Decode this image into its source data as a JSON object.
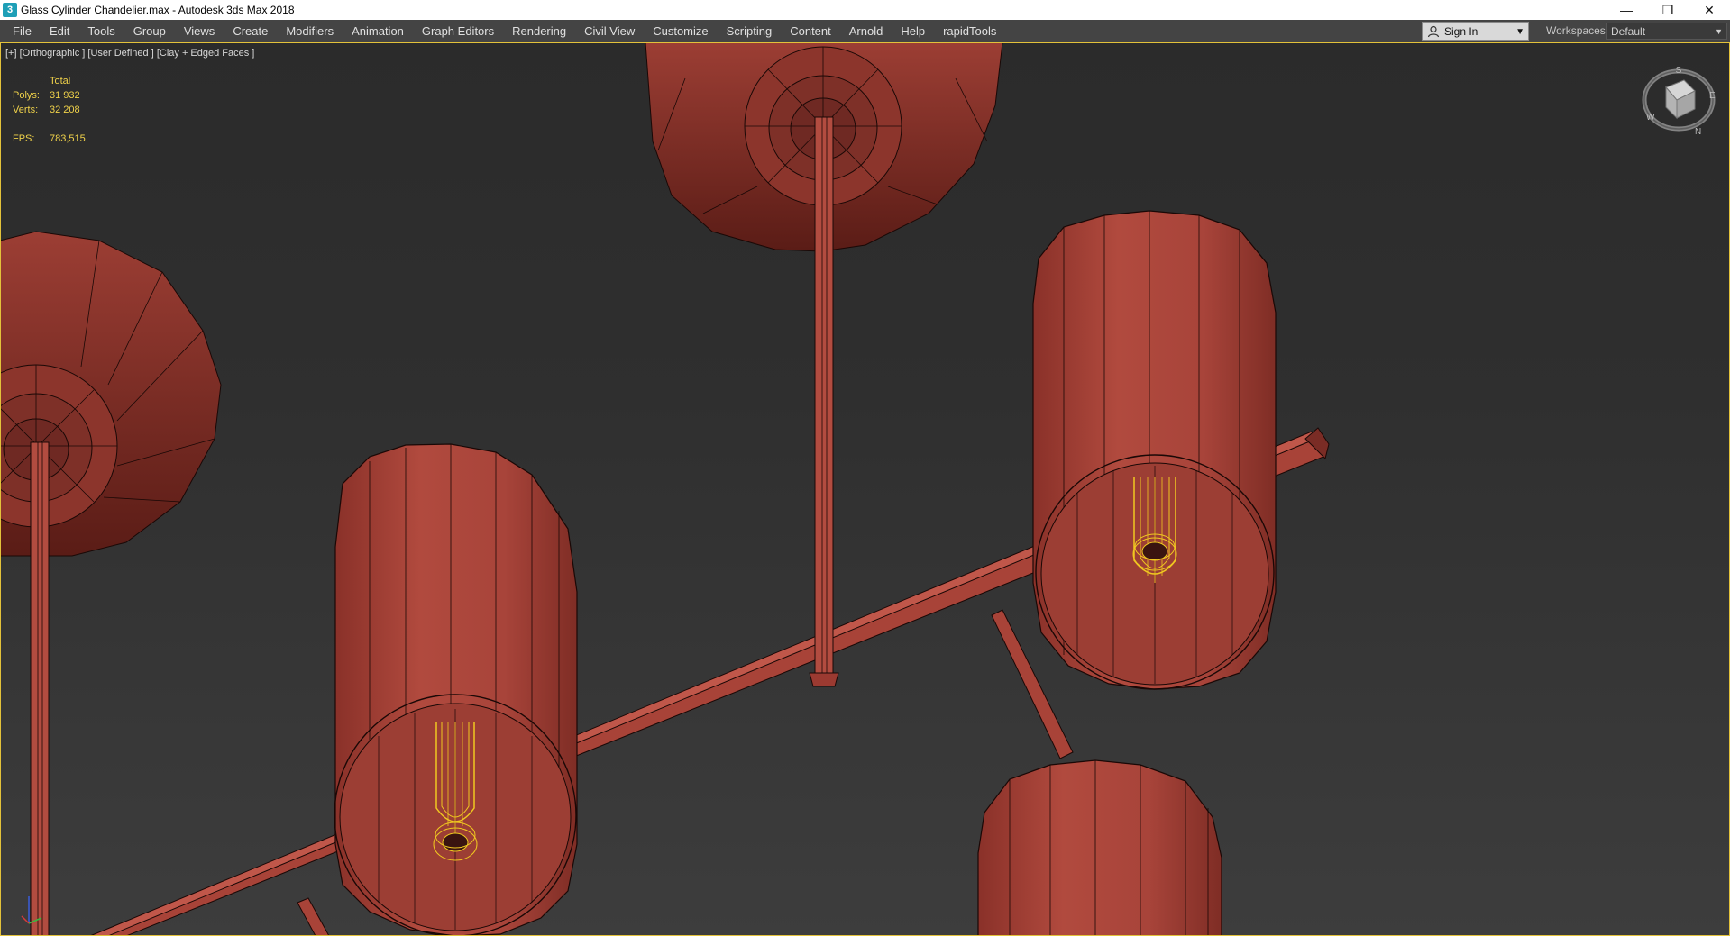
{
  "window": {
    "title": "Glass Cylinder Chandelier.max - Autodesk 3ds Max 2018",
    "app_icon_glyph": "3",
    "minimize_glyph": "—",
    "restore_glyph": "❐",
    "close_glyph": "✕"
  },
  "menu": {
    "items": [
      "File",
      "Edit",
      "Tools",
      "Group",
      "Views",
      "Create",
      "Modifiers",
      "Animation",
      "Graph Editors",
      "Rendering",
      "Civil View",
      "Customize",
      "Scripting",
      "Content",
      "Arnold",
      "Help",
      "rapidTools"
    ],
    "sign_in": "Sign In",
    "workspaces_label": "Workspaces:",
    "workspace_value": "Default"
  },
  "viewport": {
    "label": "[+] [Orthographic ] [User Defined ] [Clay + Edged Faces ]",
    "stats": {
      "header": "Total",
      "polys_label": "Polys:",
      "polys_value": "31 932",
      "verts_label": "Verts:",
      "verts_value": "32 208",
      "fps_label": "FPS:",
      "fps_value": "783,515"
    },
    "viewcube_letters": {
      "s": "S",
      "w": "W",
      "e": "E",
      "n": "N"
    },
    "colors": {
      "clay": "#a8443a",
      "clay_dark": "#7a2c25",
      "clay_light": "#c4584b",
      "edges": "#1a0806",
      "selection": "#f0c820",
      "border": "#e3c23a"
    }
  }
}
